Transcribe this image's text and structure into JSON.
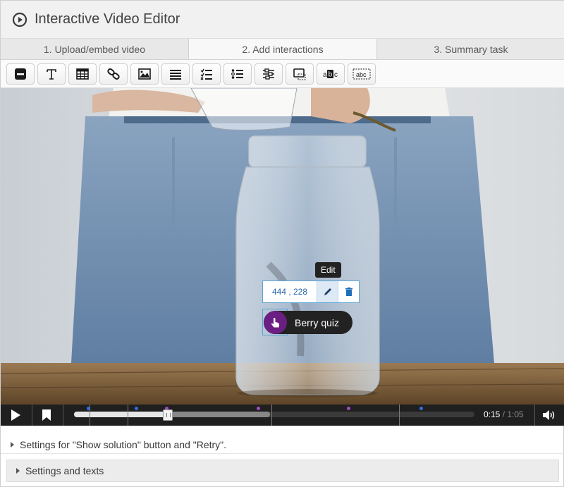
{
  "header": {
    "title": "Interactive Video Editor",
    "icon": "play-circle-icon"
  },
  "tabs": [
    {
      "label": "1. Upload/embed video",
      "active": false
    },
    {
      "label": "2. Add interactions",
      "active": true
    },
    {
      "label": "3. Summary task",
      "active": false
    }
  ],
  "toolbar": {
    "items": [
      "statement-icon",
      "text-icon",
      "table-icon",
      "link-icon",
      "image-icon",
      "list-icon",
      "checklist-icon",
      "bullet-list-icon",
      "sliders-icon",
      "navigation-hotspot-icon",
      "drag-text-icon",
      "fill-blanks-icon"
    ]
  },
  "interaction": {
    "tooltip": "Edit",
    "coordinates": "444 , 228",
    "hotspot_label": "Berry quiz",
    "hotspot_color": "#6b1f82"
  },
  "player": {
    "current_time": "0:15",
    "total_time": "/ 1:05",
    "played_fraction": 0.23,
    "buffered_fraction": 0.49,
    "marker_colors": {
      "blue": "#2f6fe0",
      "purple": "#a14bc5"
    }
  },
  "settings": {
    "show_solution_label": "Settings for \"Show solution\" button and \"Retry\".",
    "texts_label": "Settings and texts"
  }
}
